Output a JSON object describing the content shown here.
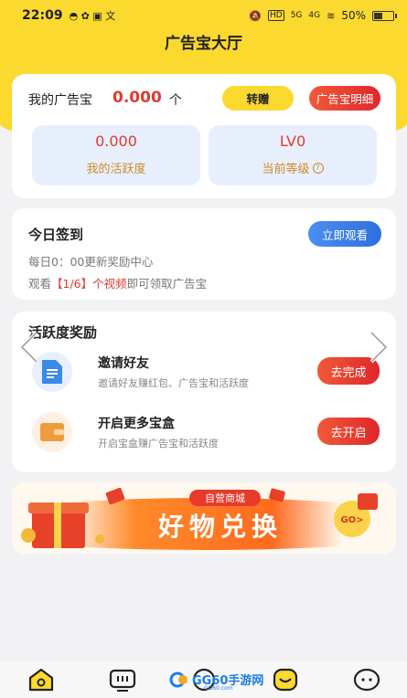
{
  "status": {
    "time": "22:09",
    "signal_text": "HD",
    "net1": "5G",
    "net2": "4G",
    "battery": "50%",
    "battery_level": 0.5
  },
  "header": {
    "title": "广告宝大厅"
  },
  "wallet": {
    "label": "我的广告宝",
    "amount": "0.000",
    "unit": "个",
    "transfer_btn": "转赠",
    "detail_btn": "广告宝明细",
    "activity_value": "0.000",
    "activity_label": "我的活跃度",
    "level_value": "LV0",
    "level_label": "当前等级",
    "help_glyph": "?"
  },
  "checkin": {
    "title": "今日签到",
    "watch_btn": "立即观看",
    "refresh_note": "每日0：00更新奖励中心",
    "prefix": "观看",
    "progress": "【1/6】个视频",
    "suffix": "即可领取广告宝"
  },
  "rewards": {
    "title": "活跃度奖励",
    "tasks": [
      {
        "title": "邀请好友",
        "desc": "邀请好友赚红包、广告宝和活跃度",
        "button": "去完成",
        "icon": "document-icon"
      },
      {
        "title": "开启更多宝盒",
        "desc": "开启宝盒赚广告宝和活跃度",
        "button": "去开启",
        "icon": "wallet-icon"
      }
    ]
  },
  "banner": {
    "tag": "自营商城",
    "headline": "好物兑换",
    "go": "GO>"
  },
  "tabbar": {
    "items": [
      "home-icon",
      "tv-icon",
      "box-icon",
      "face-icon",
      "profile-icon"
    ]
  },
  "watermark": {
    "text": "GG60手游网",
    "sub": "GG60.com"
  },
  "colors": {
    "brand_yellow": "#fbd92e",
    "accent_red": "#e23a2e",
    "accent_blue": "#2e6fe0"
  }
}
